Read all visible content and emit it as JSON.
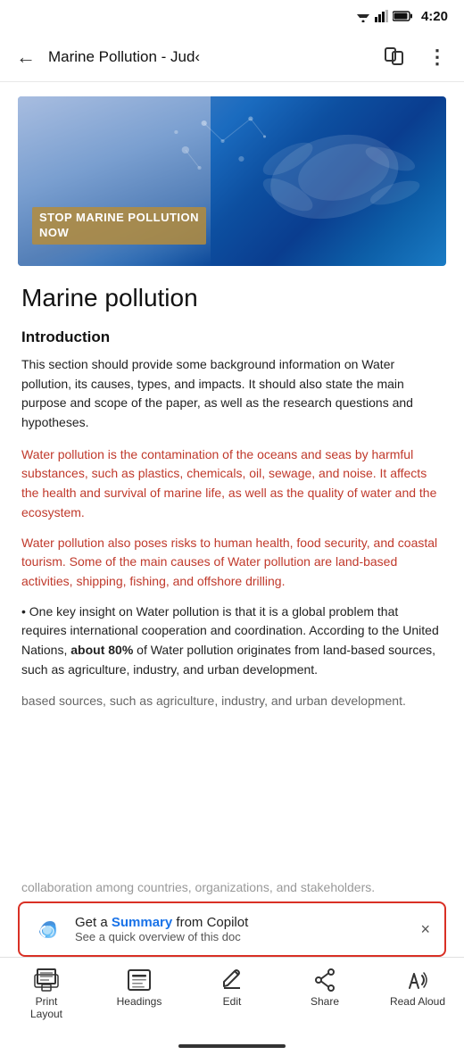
{
  "status": {
    "time": "4:20"
  },
  "topbar": {
    "back_label": "←",
    "title": "Marine Pollution - Jud‹",
    "more_label": "⋮"
  },
  "hero": {
    "text_line1": "STOP MARINE POLLUTION",
    "text_line2": "NOW"
  },
  "document": {
    "main_title": "Marine pollution",
    "section_heading": "Introduction",
    "body1": "This section should provide some background information on Water pollution, its causes, types, and impacts. It should also state the main purpose and scope of the paper, as well as the research questions and hypotheses.",
    "highlight1": "Water pollution is the contamination of the oceans and seas by harmful substances, such as plastics, chemicals, oil, sewage, and noise. It affects the health and survival of marine life, as well as the quality of water and the ecosystem.",
    "highlight2": "Water pollution also poses risks to human health, food security, and coastal tourism. Some of the main causes of Water pollution are land-based activities, shipping, fishing, and offshore drilling.",
    "body2": "• One key insight on Water pollution is that it is a global problem that requires international cooperation and coordination. According to the United Nations, ",
    "body2_bold": "about 80%",
    "body2_cont": " of Water pollution originates from land-based sources, such as agriculture, industry, and urban development.",
    "body3_partial": "based sources, such as agriculture, industry, and urban development.",
    "body_bottom": "collaboration among countries, organizations, and stakeholders."
  },
  "copilot": {
    "line1_pre": "Get a ",
    "line1_link": "Summary",
    "line1_post": " from Copilot",
    "line2": "See a quick overview of this doc",
    "close_label": "×"
  },
  "bottomnav": {
    "items": [
      {
        "id": "print-layout",
        "label": "Print\nLayout",
        "icon": "print-layout-icon"
      },
      {
        "id": "headings",
        "label": "Headings",
        "icon": "headings-icon"
      },
      {
        "id": "edit",
        "label": "Edit",
        "icon": "edit-icon"
      },
      {
        "id": "share",
        "label": "Share",
        "icon": "share-icon"
      },
      {
        "id": "read-aloud",
        "label": "Read Aloud",
        "icon": "read-aloud-icon"
      }
    ]
  }
}
